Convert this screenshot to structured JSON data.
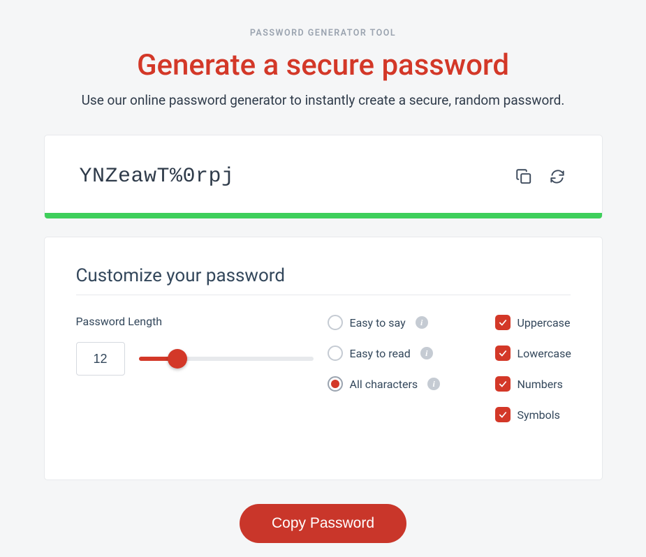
{
  "header": {
    "eyebrow": "PASSWORD GENERATOR TOOL",
    "title": "Generate a secure password",
    "subtitle": "Use our online password generator to instantly create a secure, random password."
  },
  "password": {
    "value": "YNZeawT%0rpj",
    "strength_color": "#3ecf5b"
  },
  "customize": {
    "section_title": "Customize your password",
    "length": {
      "label": "Password Length",
      "value": "12",
      "min": 1,
      "max": 50
    },
    "modes": [
      {
        "label": "Easy to say",
        "selected": false
      },
      {
        "label": "Easy to read",
        "selected": false
      },
      {
        "label": "All characters",
        "selected": true
      }
    ],
    "charsets": [
      {
        "label": "Uppercase",
        "checked": true
      },
      {
        "label": "Lowercase",
        "checked": true
      },
      {
        "label": "Numbers",
        "checked": true
      },
      {
        "label": "Symbols",
        "checked": true
      }
    ]
  },
  "actions": {
    "copy_button": "Copy Password"
  },
  "colors": {
    "accent": "#d33828"
  }
}
